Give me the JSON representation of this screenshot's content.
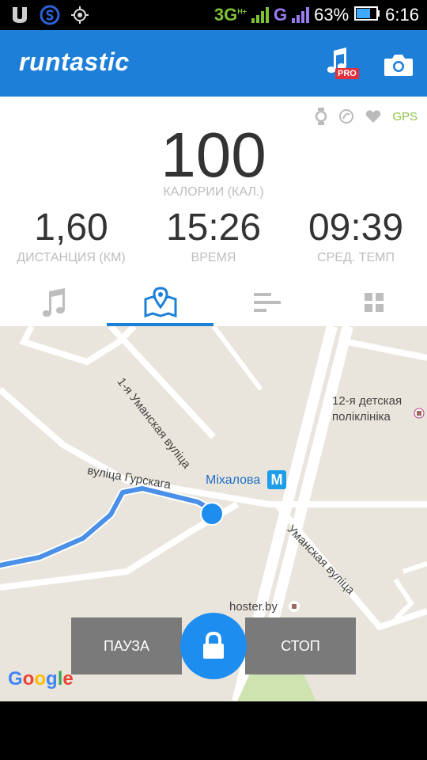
{
  "status_bar": {
    "network": "3G",
    "network_sup": "H+",
    "network2": "G",
    "battery": "63%",
    "time": "6:16",
    "icons": [
      "u-app-icon",
      "s-app-icon",
      "gps-target-icon"
    ]
  },
  "app": {
    "logo": "runtastic",
    "pro_badge": "PRO"
  },
  "sensors": {
    "gps": "GPS"
  },
  "stats": {
    "calories_value": "100",
    "calories_label": "КАЛОРИИ (КАЛ.)",
    "distance_value": "1,60",
    "distance_label": "ДИСТАНЦИЯ (КМ)",
    "time_value": "15:26",
    "time_label": "ВРЕМЯ",
    "pace_value": "09:39",
    "pace_label": "СРЕД. ТЕМП"
  },
  "tabs": {
    "active": "map",
    "items": [
      "music-icon",
      "map-icon",
      "splits-icon",
      "dashboard-icon"
    ]
  },
  "map": {
    "street1": "1-я Уманская вуліца",
    "street2": "вуліца Гурскага",
    "street3": "Уманская вуліца",
    "poi1_line1": "12-я детская",
    "poi1_line2": "поліклініка",
    "metro_station": "Міхалова",
    "metro_letter": "M",
    "poi2": "hoster.by",
    "attribution": "Google"
  },
  "controls": {
    "pause": "ПАУЗА",
    "stop": "СТОП"
  },
  "colors": {
    "brand": "#1e7fd9",
    "route": "#4a8fe8",
    "control_bg": "#7a7a7a"
  }
}
